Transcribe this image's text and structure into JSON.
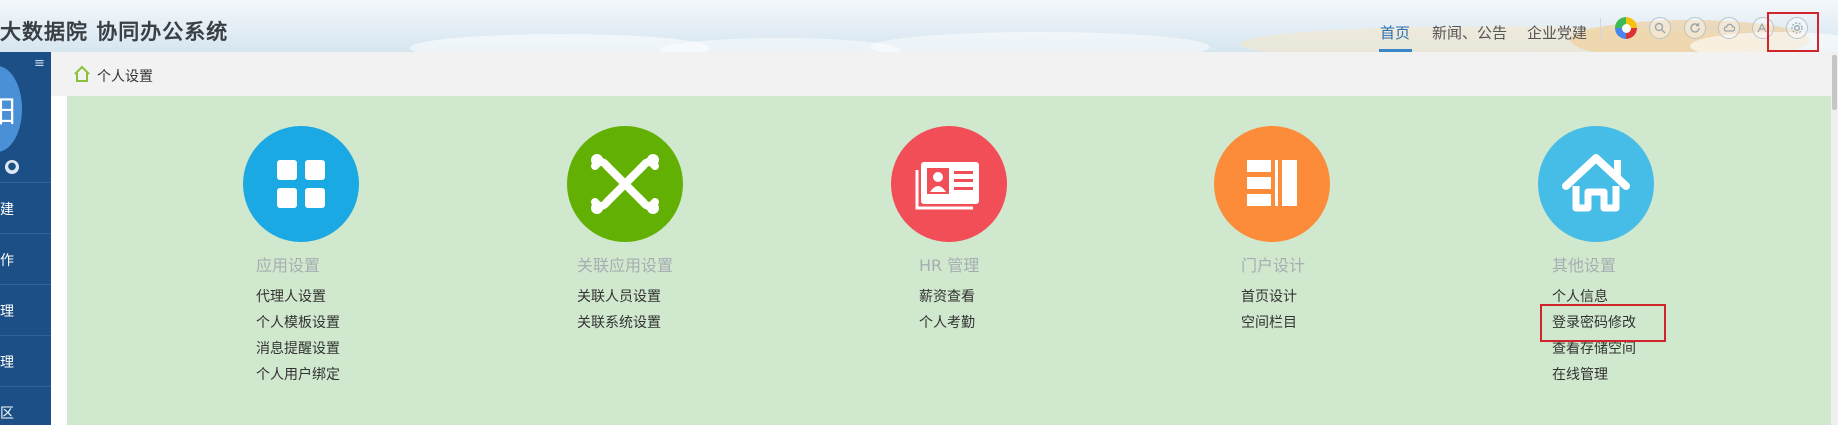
{
  "header": {
    "app_title": "大数据院 协同办公系统",
    "nav": [
      {
        "label": "首页",
        "active": true
      },
      {
        "label": "新闻、公告",
        "active": false
      },
      {
        "label": "企业党建",
        "active": false
      }
    ],
    "icons": [
      "color-wheel-icon",
      "search-icon",
      "refresh-icon",
      "cloud-icon",
      "font-icon",
      "settings-icon"
    ],
    "accent_color": "#3a86c8"
  },
  "sidebar": {
    "avatar_char": "阳",
    "items": [
      {
        "label": "建"
      },
      {
        "label": "作"
      },
      {
        "label": "理"
      },
      {
        "label": "理"
      },
      {
        "label": "区"
      }
    ],
    "background_color": "#1c4f86"
  },
  "breadcrumb": {
    "label": "个人设置"
  },
  "sections": [
    {
      "title": "应用设置",
      "icon": "grid-icon",
      "color": "#1aa9e3",
      "links": [
        "代理人设置",
        "个人模板设置",
        "消息提醒设置",
        "个人用户绑定"
      ]
    },
    {
      "title": "关联应用设置",
      "icon": "joomla-link-icon",
      "color": "#63b004",
      "links": [
        "关联人员设置",
        "关联系统设置"
      ]
    },
    {
      "title": "HR 管理",
      "icon": "contact-card-icon",
      "color": "#f24e57",
      "links": [
        "薪资查看",
        "个人考勤"
      ]
    },
    {
      "title": "门户设计",
      "icon": "portal-layout-icon",
      "color": "#fd8c3a",
      "links": [
        "首页设计",
        "空间栏目"
      ]
    },
    {
      "title": "其他设置",
      "icon": "house-icon",
      "color": "#45bde6",
      "links": [
        "个人信息",
        "登录密码修改",
        "查看存储空间",
        "在线管理"
      ]
    }
  ],
  "content_background": "#d0e8cd"
}
